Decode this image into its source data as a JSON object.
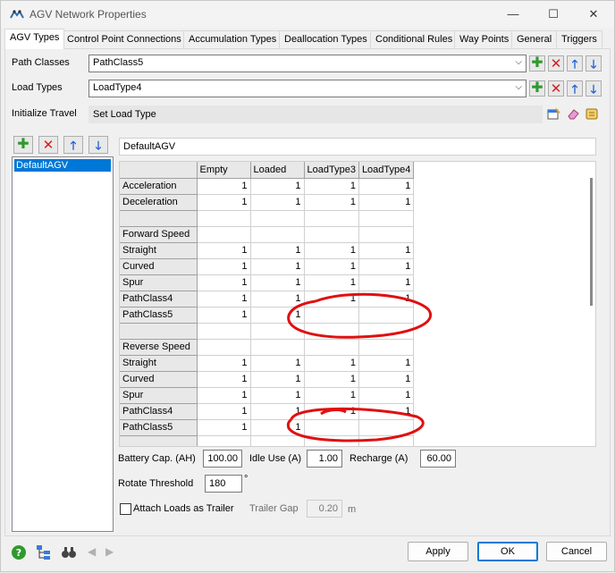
{
  "window": {
    "title": "AGV Network Properties",
    "minimize": "—",
    "maximize": "☐",
    "close": "✕"
  },
  "tabs": [
    {
      "label": "AGV Types",
      "active": true
    },
    {
      "label": "Control Point Connections"
    },
    {
      "label": "Accumulation Types"
    },
    {
      "label": "Deallocation Types"
    },
    {
      "label": "Conditional Rules"
    },
    {
      "label": "Way Points"
    },
    {
      "label": "General"
    },
    {
      "label": "Triggers"
    }
  ],
  "form": {
    "path_classes_label": "Path Classes",
    "path_classes_value": "PathClass5",
    "load_types_label": "Load Types",
    "load_types_value": "LoadType4",
    "initialize_travel_label": "Initialize Travel",
    "initialize_travel_value": "Set Load Type"
  },
  "agv_list": {
    "items": [
      "DefaultAGV"
    ],
    "selected": "DefaultAGV"
  },
  "agv_name": "DefaultAGV",
  "table": {
    "columns": [
      "",
      "Empty",
      "Loaded",
      "LoadType3",
      "LoadType4"
    ],
    "rows": [
      {
        "label": "Acceleration",
        "values": [
          "1",
          "1",
          "1",
          "1"
        ]
      },
      {
        "label": "Deceleration",
        "values": [
          "1",
          "1",
          "1",
          "1"
        ]
      },
      {
        "label": "",
        "values": [
          "",
          "",
          "",
          ""
        ]
      },
      {
        "label": "Forward Speed",
        "values": [
          "",
          "",
          "",
          ""
        ]
      },
      {
        "label": "Straight",
        "values": [
          "1",
          "1",
          "1",
          "1"
        ]
      },
      {
        "label": "Curved",
        "values": [
          "1",
          "1",
          "1",
          "1"
        ]
      },
      {
        "label": "Spur",
        "values": [
          "1",
          "1",
          "1",
          "1"
        ]
      },
      {
        "label": "PathClass4",
        "values": [
          "1",
          "1",
          "1",
          "1"
        ]
      },
      {
        "label": "PathClass5",
        "values": [
          "1",
          "1",
          "",
          ""
        ]
      },
      {
        "label": "",
        "values": [
          "",
          "",
          "",
          ""
        ]
      },
      {
        "label": "Reverse Speed",
        "values": [
          "",
          "",
          "",
          ""
        ]
      },
      {
        "label": "Straight",
        "values": [
          "1",
          "1",
          "1",
          "1"
        ]
      },
      {
        "label": "Curved",
        "values": [
          "1",
          "1",
          "1",
          "1"
        ]
      },
      {
        "label": "Spur",
        "values": [
          "1",
          "1",
          "1",
          "1"
        ]
      },
      {
        "label": "PathClass4",
        "values": [
          "1",
          "1",
          "1",
          "1"
        ]
      },
      {
        "label": "PathClass5",
        "values": [
          "1",
          "1",
          "",
          ""
        ]
      },
      {
        "label": "",
        "values": [
          "",
          "",
          "",
          ""
        ]
      }
    ]
  },
  "battery": {
    "capacity_label": "Battery Cap. (AH)",
    "capacity_value": "100.00",
    "idle_label": "Idle Use (A)",
    "idle_value": "1.00",
    "recharge_label": "Recharge (A)",
    "recharge_value": "60.00"
  },
  "rotate": {
    "label": "Rotate Threshold",
    "value": "180",
    "unit": "°"
  },
  "trailer": {
    "attach_label": "Attach Loads as Trailer",
    "attach_checked": false,
    "gap_label": "Trailer Gap",
    "gap_value": "0.20",
    "gap_unit": "m"
  },
  "buttons": {
    "apply": "Apply",
    "ok": "OK",
    "cancel": "Cancel"
  },
  "colors": {
    "selection": "#0078d7",
    "annotation": "#e01010",
    "add_green": "#2e9a2e",
    "remove_red": "#d02020",
    "arrow_blue": "#1f5fd6"
  }
}
